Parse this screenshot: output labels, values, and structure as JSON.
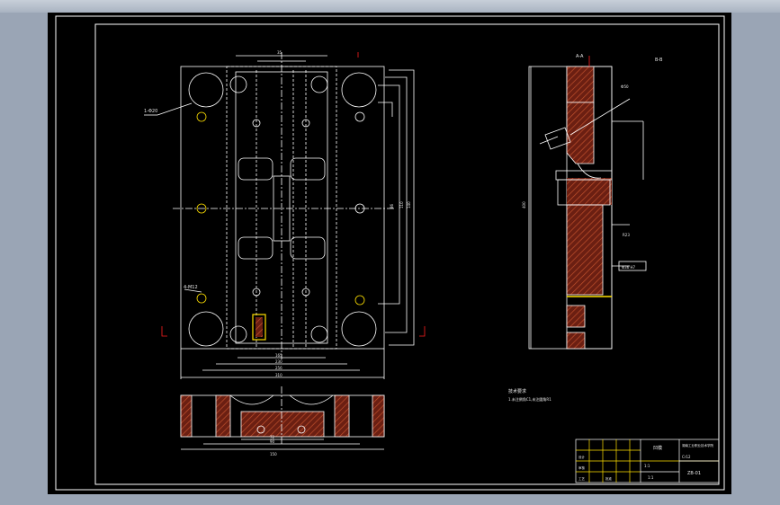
{
  "view": {
    "background_color": "#000000",
    "line_color": "#ffffff",
    "hatch_color": "#8b2a1a",
    "highlight_color": "#ffe000",
    "frame_color": "#ffffff"
  },
  "labels": {
    "hole_note_left": "1-Φ20",
    "callout_mid_left": "4-M12",
    "dim_top_width": "35",
    "dim_side_1": "86",
    "dim_side_2": "110",
    "dim_side_3": "140",
    "dim_bottom_1": "165",
    "dim_bottom_2": "230",
    "dim_bottom_3": "256",
    "dim_overall": "310",
    "section_label_top": "A-A",
    "section_label_right": "B-B",
    "tech_req_title": "技术要求",
    "tech_req_line1": "1.未注倒角C1,未注圆角R1",
    "right_dim_height": "400",
    "right_note": "R23",
    "right_tag": "Ф50",
    "right_fit": "Φ36 H7",
    "bottom_dim_1": "72",
    "bottom_dim_2": "90",
    "bottom_dim_3": "150"
  },
  "title_block": {
    "drawing_name": "凹模",
    "company": "湖南工业职业技术学院",
    "material": "Cr12",
    "sheet": "1:1",
    "drawing_no": "ZB-01",
    "scale": "1:1",
    "rows": [
      "设计",
      "审核",
      "工艺",
      "批准"
    ]
  }
}
